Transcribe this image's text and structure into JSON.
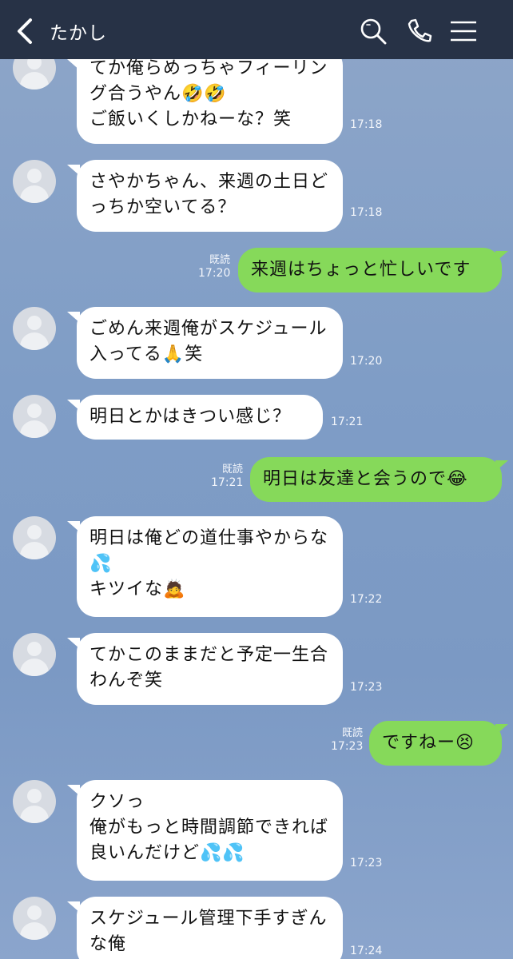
{
  "header": {
    "contact_name": "たかし"
  },
  "icons": {
    "back": "chevron-left-icon",
    "search": "search-icon",
    "phone": "phone-icon",
    "menu": "menu-icon"
  },
  "messages": [
    {
      "side": "left",
      "text": "てか俺らめっちゃフィーリング合うやん🤣🤣\nご飯いくしかねーな？笑",
      "time": "17:18"
    },
    {
      "side": "left",
      "text": "さやかちゃん、来週の土日どっちか空いてる？",
      "time": "17:18"
    },
    {
      "side": "right",
      "text": "来週はちょっと忙しいです",
      "time": "17:20",
      "read": "既読"
    },
    {
      "side": "left",
      "text": "ごめん来週俺がスケジュール入ってる🙏笑",
      "time": "17:20"
    },
    {
      "side": "left",
      "text": "明日とかはきつい感じ？",
      "time": "17:21"
    },
    {
      "side": "right",
      "text": "明日は友達と会うので😂",
      "time": "17:21",
      "read": "既読"
    },
    {
      "side": "left",
      "text": "明日は俺どの道仕事やからな💦\nキツイな🙇",
      "time": "17:22"
    },
    {
      "side": "left",
      "text": "てかこのままだと予定一生合わんぞ笑",
      "time": "17:23"
    },
    {
      "side": "right",
      "text": "ですねー😣",
      "time": "17:23",
      "read": "既読"
    },
    {
      "side": "left",
      "text": "クソっ\n俺がもっと時間調節できれば良いんだけど💦💦",
      "time": "17:23"
    },
    {
      "side": "left",
      "text": "スケジュール管理下手すぎんな俺",
      "time": "17:24"
    }
  ]
}
